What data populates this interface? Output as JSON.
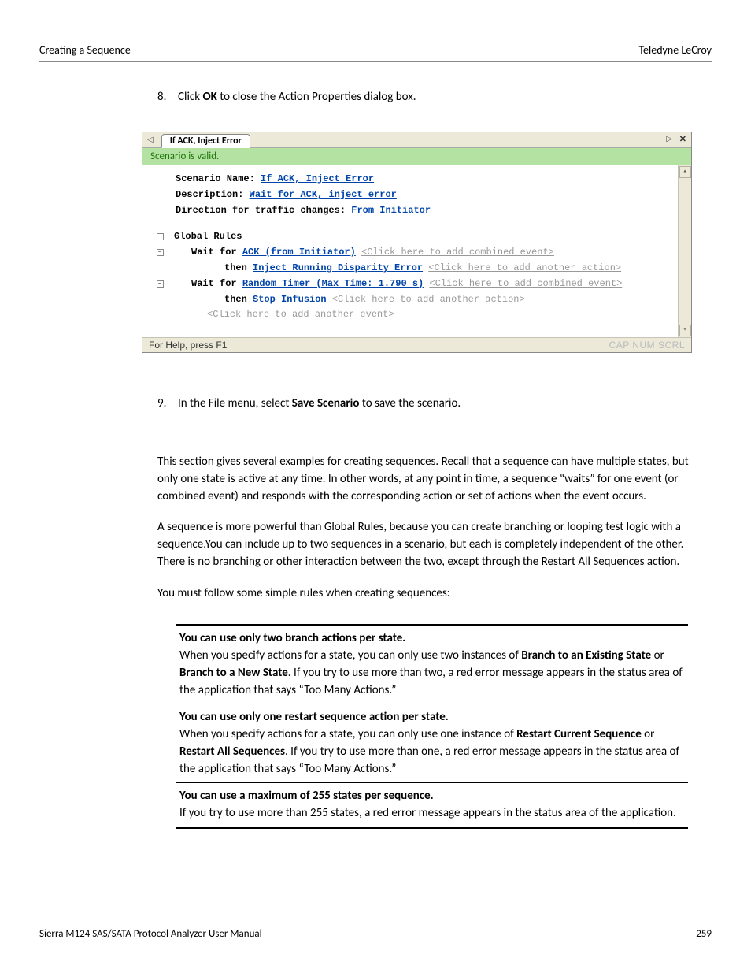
{
  "header": {
    "left": "Creating a Sequence",
    "right": "Teledyne LeCroy"
  },
  "steps": {
    "s8": {
      "num": "8.",
      "pre": "Click ",
      "bold": "OK",
      "post": " to close the Action Properties dialog box."
    },
    "s9": {
      "num": "9.",
      "pre": "In the File menu, select ",
      "bold": "Save Scenario",
      "post": " to save the scenario."
    }
  },
  "screenshot": {
    "tab": "If ACK, Inject Error",
    "valid": "Scenario is valid.",
    "sn_label": "Scenario Name: ",
    "sn_value": "If ACK, Inject Error",
    "desc_label": "Description: ",
    "desc_value": "Wait for ACK, inject error",
    "dir_label": "Direction for traffic changes: ",
    "dir_value": "From Initiator",
    "global": "Global Rules",
    "r1_a": "Wait for ",
    "r1_b": "ACK (from Initiator)",
    "r1_c": "<Click here to add combined event>",
    "r1_then": "then ",
    "r1_act": "Inject Running Disparity Error",
    "r1_act_hint": "<Click here to add another action>",
    "r2_a": "Wait for ",
    "r2_b": "Random Timer (Max Time: 1.790 s)",
    "r2_c": "<Click here to add combined event>",
    "r2_then": "then ",
    "r2_act": "Stop Infusion",
    "r2_act_hint": "<Click here to add another action>",
    "add_event": "<Click here to add another event>",
    "status_left": "For Help, press F1",
    "status_right": "CAP NUM SCRL"
  },
  "paras": {
    "p1": "This section gives several examples for creating sequences. Recall that a sequence can have multiple states, but only one state is active at any time. In other words, at any point in time, a sequence “waits” for one event (or combined event) and responds with the corresponding action or set of actions when the event occurs.",
    "p2": "A sequence is more powerful than Global Rules, because you can create branching or looping test logic with a sequence.You can include up to two sequences in a scenario, but each is completely independent of the other. There is no branching or other interaction between the two, except through the Restart All Sequences action.",
    "p3": "You must follow some simple rules when creating sequences:"
  },
  "rules": {
    "c1_h": "You can use only two branch actions per state.",
    "c1_a": "When you specify actions for a state, you can only use two instances of ",
    "c1_b1": "Branch to an Existing State",
    "c1_or": " or ",
    "c1_b2": "Branch to a New State",
    "c1_c": ". If you try to use more than two, a red error message appears in the status area of the application that says “Too Many Actions.”",
    "c2_h": "You can use only one restart sequence action per state.",
    "c2_a": "When you specify actions for a state, you can only use one instance of ",
    "c2_b1": "Restart Current Sequence",
    "c2_or": " or ",
    "c2_b2": "Restart All Sequences",
    "c2_c": ". If you try to use more than one, a red error message appears in the status area of the application that says “Too Many Actions.”",
    "c3_h": "You can use a maximum of 255 states per sequence.",
    "c3_a": "If you try to use more than 255 states, a red error message appears in the status area of the application."
  },
  "footer": {
    "title": "Sierra M124 SAS/SATA Protocol Analyzer User Manual",
    "page": "259"
  }
}
